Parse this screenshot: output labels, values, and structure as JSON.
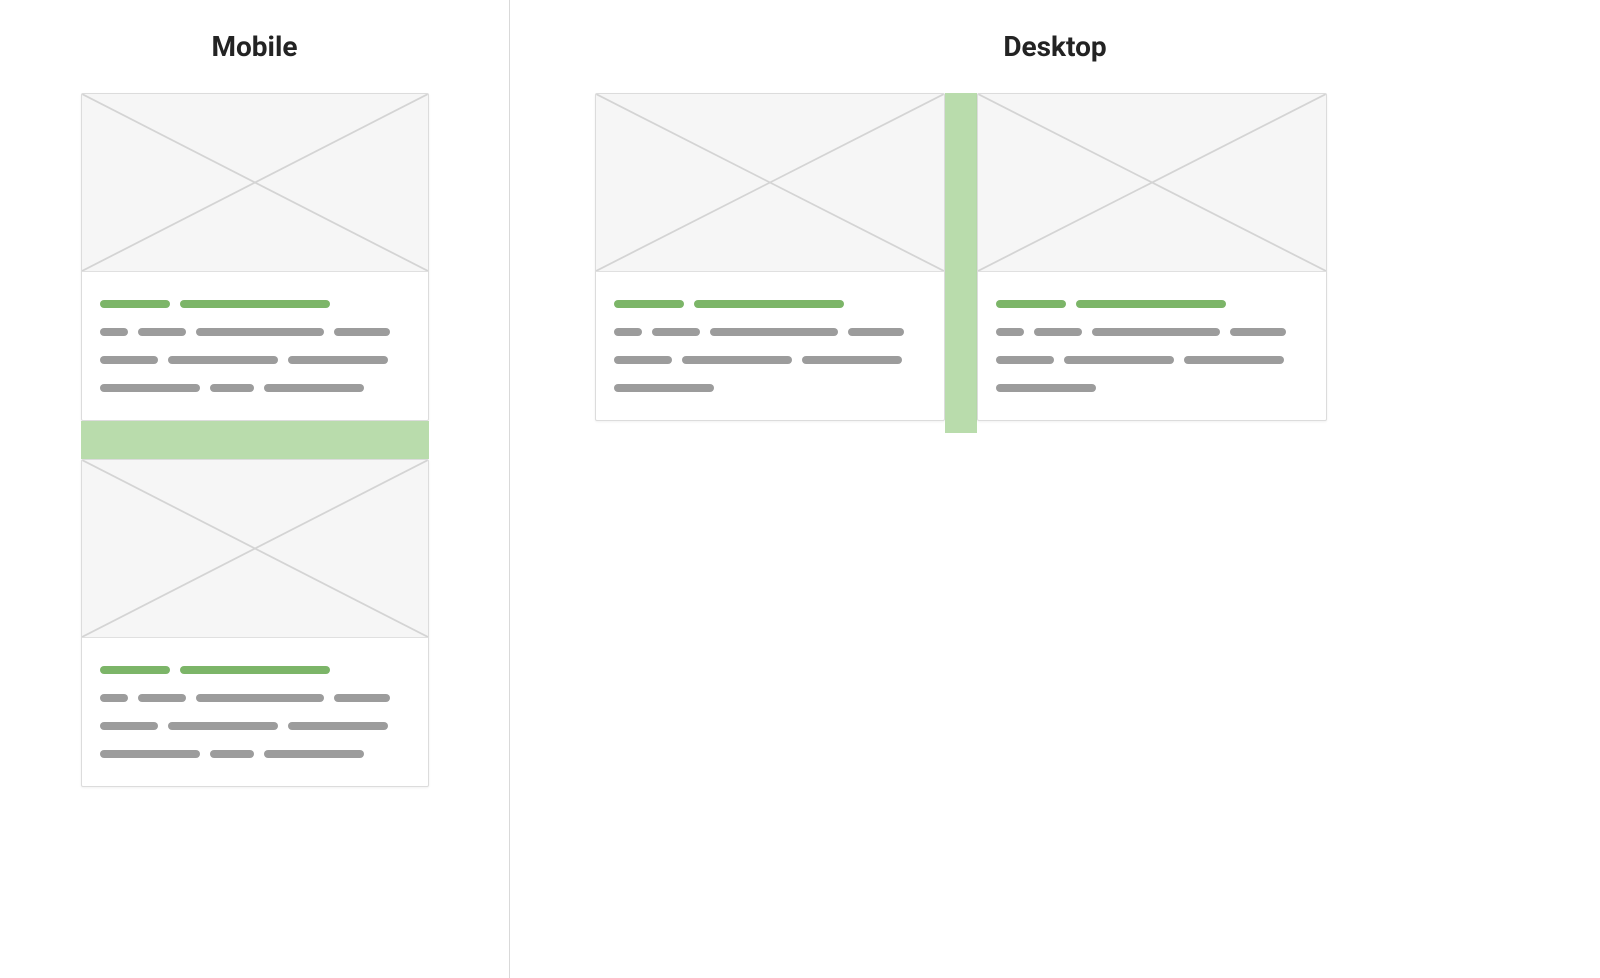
{
  "labels": {
    "mobile": "Mobile",
    "desktop": "Desktop"
  },
  "colors": {
    "gapFill": "#b9dcac",
    "titleSeg": "#7cb568",
    "bodySeg": "#9c9c9c",
    "cardBorder": "#dcdcdc",
    "imageFill": "#f6f6f6"
  },
  "mobile": {
    "orientation": "vertical",
    "gapBandHeightPx": 38,
    "cards": [
      {
        "imageHeightPx": 178,
        "titleSegments": [
          70,
          150
        ],
        "bodyLines": [
          [
            28,
            48,
            128,
            56
          ],
          [
            58,
            110,
            100
          ],
          [
            100,
            44,
            100
          ]
        ]
      },
      {
        "imageHeightPx": 178,
        "titleSegments": [
          70,
          150
        ],
        "bodyLines": [
          [
            28,
            48,
            128,
            56
          ],
          [
            58,
            110,
            100
          ],
          [
            100,
            44,
            100
          ]
        ]
      }
    ]
  },
  "desktop": {
    "orientation": "horizontal",
    "gapBandWidthPx": 32,
    "cards": [
      {
        "imageHeightPx": 178,
        "titleSegments": [
          70,
          150
        ],
        "bodyLines": [
          [
            28,
            48,
            128,
            56
          ],
          [
            58,
            110,
            100
          ],
          [
            100
          ]
        ]
      },
      {
        "imageHeightPx": 178,
        "titleSegments": [
          70,
          150
        ],
        "bodyLines": [
          [
            28,
            48,
            128,
            56
          ],
          [
            58,
            110,
            100
          ],
          [
            100
          ]
        ]
      }
    ]
  }
}
